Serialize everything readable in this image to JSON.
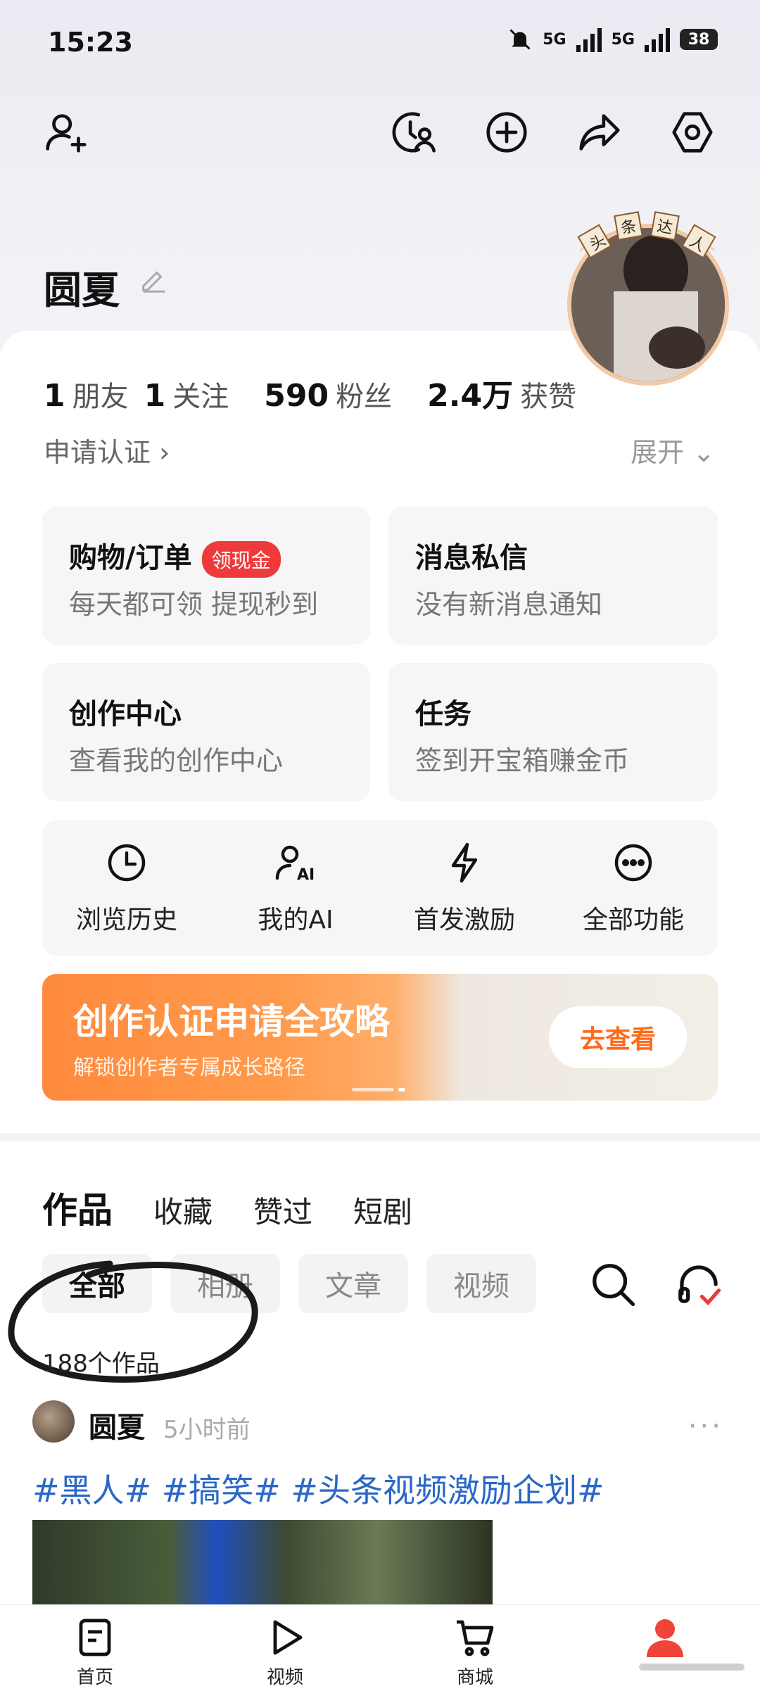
{
  "status_bar": {
    "time": "15:23",
    "net1": "5G",
    "net2": "5G",
    "battery": "38"
  },
  "profile": {
    "name": "圆夏",
    "badge_chars": [
      "头",
      "条",
      "达",
      "人"
    ],
    "stats": [
      {
        "num": "1",
        "label": "朋友"
      },
      {
        "num": "1",
        "label": "关注"
      },
      {
        "num": "590",
        "label": "粉丝"
      },
      {
        "num": "2.4万",
        "label": "获赞"
      }
    ],
    "apply_cert": "申请认证 ›",
    "expand": "展开 ⌄"
  },
  "tiles": [
    {
      "title": "购物/订单",
      "badge": "领现金",
      "sub": "每天都可领 提现秒到"
    },
    {
      "title": "消息私信",
      "sub": "没有新消息通知"
    },
    {
      "title": "创作中心",
      "sub": "查看我的创作中心"
    },
    {
      "title": "任务",
      "sub": "签到开宝箱赚金币"
    }
  ],
  "quick_actions": [
    {
      "label": "浏览历史",
      "icon": "clock-icon"
    },
    {
      "label": "我的AI",
      "icon": "ai-person-icon"
    },
    {
      "label": "首发激励",
      "icon": "lightning-icon"
    },
    {
      "label": "全部功能",
      "icon": "more-circle-icon"
    }
  ],
  "banner": {
    "title": "创作认证申请全攻略",
    "sub": "解锁创作者专属成长路径",
    "button": "去查看"
  },
  "content_tabs": [
    "作品",
    "收藏",
    "赞过",
    "短剧"
  ],
  "filters": [
    "全部",
    "相册",
    "文章",
    "视频"
  ],
  "works_count": "188个作品",
  "post": {
    "author": "圆夏",
    "time": "5小时前",
    "more": "···",
    "tags": "#黑人# #搞笑# #头条视频激励企划#"
  },
  "bottom_nav": [
    {
      "label": "首页",
      "icon": "home-doc-icon"
    },
    {
      "label": "视频",
      "icon": "play-icon"
    },
    {
      "label": "商城",
      "icon": "cart-icon"
    },
    {
      "label": "",
      "icon": "profile-icon"
    }
  ],
  "colors": {
    "accent_red": "#ee3a3a",
    "tag_blue": "#2a67c8",
    "banner_orange": "#ff8a3d",
    "profile_red": "#f04438"
  }
}
